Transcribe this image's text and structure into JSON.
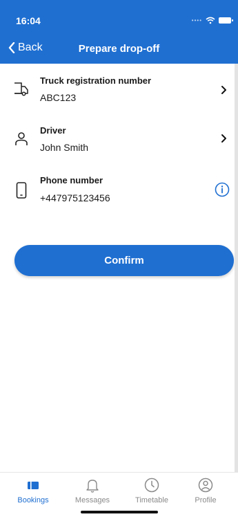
{
  "status": {
    "time": "16:04"
  },
  "nav": {
    "back_label": "Back",
    "title": "Prepare drop-off"
  },
  "rows": [
    {
      "label": "Truck registration number",
      "value": "ABC123"
    },
    {
      "label": "Driver",
      "value": "John Smith"
    },
    {
      "label": "Phone number",
      "value": "+447975123456"
    }
  ],
  "actions": {
    "confirm_label": "Confirm"
  },
  "tabs": [
    {
      "label": "Bookings",
      "icon": "bookings-icon",
      "active": true
    },
    {
      "label": "Messages",
      "icon": "bell-icon",
      "active": false
    },
    {
      "label": "Timetable",
      "icon": "clock-icon",
      "active": false
    },
    {
      "label": "Profile",
      "icon": "profile-icon",
      "active": false
    }
  ],
  "colors": {
    "primary": "#1f6fd1",
    "inactive": "#8a8a8a"
  }
}
